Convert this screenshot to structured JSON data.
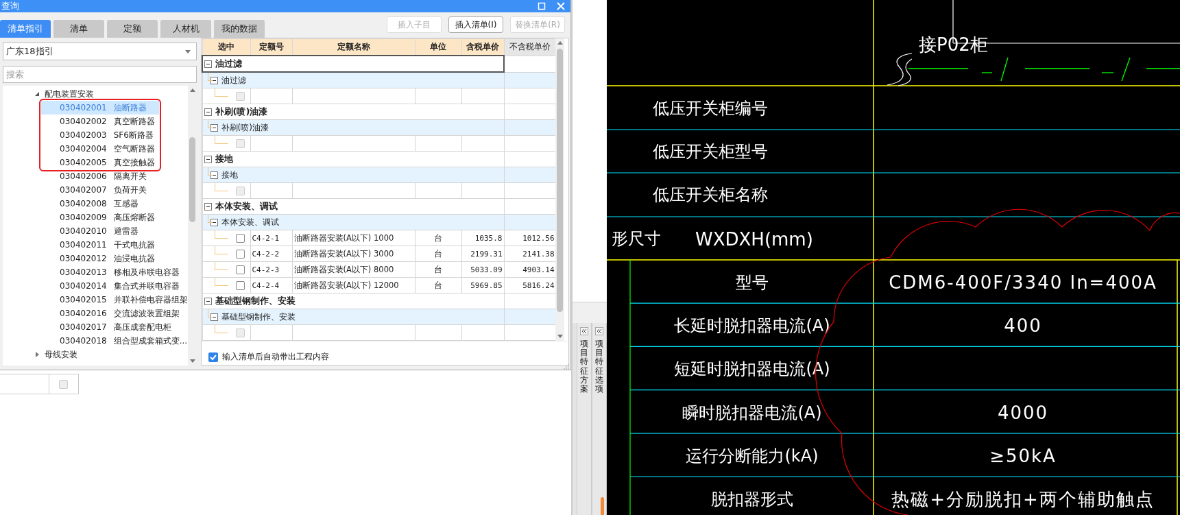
{
  "dialog": {
    "title": "查询",
    "tabs": [
      {
        "label": "清单指引",
        "selected": true
      },
      {
        "label": "清单",
        "selected": false
      },
      {
        "label": "定额",
        "selected": false
      },
      {
        "label": "人材机",
        "selected": false
      },
      {
        "label": "我的数据",
        "selected": false
      }
    ],
    "buttons": [
      {
        "label": "插入子目",
        "disabled": true
      },
      {
        "label": "插入清单(I)",
        "disabled": false
      },
      {
        "label": "替换清单(R)",
        "disabled": true
      }
    ],
    "guide": {
      "dropdown": "广东18指引",
      "search": {
        "placeholder": "搜索"
      },
      "tree": [
        {
          "label": "配电装置安装",
          "expanded": true,
          "children": [
            {
              "code": "030402001",
              "name": "油断路器",
              "selected": true,
              "highlighted": true
            },
            {
              "code": "030402002",
              "name": "真空断路器",
              "selected": false,
              "highlighted": true
            },
            {
              "code": "030402003",
              "name": "SF6断路器",
              "selected": false,
              "highlighted": true
            },
            {
              "code": "030402004",
              "name": "空气断路器",
              "selected": false,
              "highlighted": true
            },
            {
              "code": "030402005",
              "name": "真空接触器",
              "selected": false,
              "highlighted": true
            },
            {
              "code": "030402006",
              "name": "隔离开关",
              "selected": false,
              "highlighted": false
            },
            {
              "code": "030402007",
              "name": "负荷开关",
              "selected": false,
              "highlighted": false
            },
            {
              "code": "030402008",
              "name": "互感器",
              "selected": false,
              "highlighted": false
            },
            {
              "code": "030402009",
              "name": "高压熔断器",
              "selected": false,
              "highlighted": false
            },
            {
              "code": "030402010",
              "name": "避雷器",
              "selected": false,
              "highlighted": false
            },
            {
              "code": "030402011",
              "name": "干式电抗器",
              "selected": false,
              "highlighted": false
            },
            {
              "code": "030402012",
              "name": "油浸电抗器",
              "selected": false,
              "highlighted": false
            },
            {
              "code": "030402013",
              "name": "移相及串联电容器",
              "selected": false,
              "highlighted": false
            },
            {
              "code": "030402014",
              "name": "集合式并联电容器",
              "selected": false,
              "highlighted": false
            },
            {
              "code": "030402015",
              "name": "并联补偿电容器组架",
              "selected": false,
              "highlighted": false
            },
            {
              "code": "030402016",
              "name": "交流滤波装置组架",
              "selected": false,
              "highlighted": false
            },
            {
              "code": "030402017",
              "name": "高压成套配电柜",
              "selected": false,
              "highlighted": false
            },
            {
              "code": "030402018",
              "name": "组合型成套箱式变...",
              "selected": false,
              "highlighted": false
            }
          ]
        },
        {
          "label": "母线安装",
          "expanded": false
        }
      ]
    },
    "table": {
      "columns": [
        "选中",
        "定额号",
        "定额名称",
        "单位",
        "含税单价",
        "不含税单价"
      ],
      "rows": [
        {
          "kind": "group",
          "label": "油过滤",
          "expanded": true
        },
        {
          "kind": "subgroup",
          "label": "油过滤",
          "expanded": true
        },
        {
          "kind": "item",
          "checked": false,
          "disabled": true
        },
        {
          "kind": "group",
          "label": "补刷(喷)油漆",
          "expanded": true
        },
        {
          "kind": "subgroup",
          "label": "补刷(喷)油漆",
          "expanded": true
        },
        {
          "kind": "item",
          "checked": false,
          "disabled": true
        },
        {
          "kind": "group",
          "label": "接地",
          "expanded": true
        },
        {
          "kind": "subgroup",
          "label": "接地",
          "expanded": true
        },
        {
          "kind": "item",
          "checked": false,
          "disabled": true
        },
        {
          "kind": "group",
          "label": "本体安装、调试",
          "expanded": true
        },
        {
          "kind": "subgroup",
          "label": "本体安装、调试",
          "expanded": true
        },
        {
          "kind": "item",
          "checked": false,
          "disabled": false,
          "code": "C4-2-1",
          "name": "油断路器安装(A以下) 1000",
          "unit": "台",
          "tax_price": "1035.8",
          "pretax_price": "1012.56"
        },
        {
          "kind": "item",
          "checked": false,
          "disabled": false,
          "code": "C4-2-2",
          "name": "油断路器安装(A以下) 3000",
          "unit": "台",
          "tax_price": "2199.31",
          "pretax_price": "2141.38"
        },
        {
          "kind": "item",
          "checked": false,
          "disabled": false,
          "code": "C4-2-3",
          "name": "油断路器安装(A以下) 8000",
          "unit": "台",
          "tax_price": "5033.09",
          "pretax_price": "4903.14"
        },
        {
          "kind": "item",
          "checked": false,
          "disabled": false,
          "code": "C4-2-4",
          "name": "油断路器安装(A以下) 12000",
          "unit": "台",
          "tax_price": "5969.85",
          "pretax_price": "5816.24"
        },
        {
          "kind": "group",
          "label": "基础型钢制作、安装",
          "expanded": true
        },
        {
          "kind": "subgroup",
          "label": "基础型钢制作、安装",
          "expanded": true
        },
        {
          "kind": "item",
          "checked": false,
          "disabled": true
        }
      ]
    },
    "auto_option": {
      "label": "输入清单后自动带出工程内容",
      "checked": true
    }
  },
  "background_table": {
    "rows": [
      {
        "checked": false,
        "disabled": true
      }
    ]
  },
  "side_panel": {
    "tabs": [
      {
        "label": "项目特征方案"
      },
      {
        "label": "项目特征选项"
      }
    ]
  },
  "drawing": {
    "cable_label": "接P02柜",
    "header_rows": [
      {
        "label": "低压开关柜编号"
      },
      {
        "label": "低压开关柜型号"
      },
      {
        "label": "低压开关柜名称"
      }
    ],
    "dimension_row": {
      "label": "形尺寸",
      "value": "WXDXH(mm)"
    },
    "spec_rows": [
      {
        "label": "型号",
        "value": "CDM6-400F/3340 In=400A"
      },
      {
        "label": "长延时脱扣器电流(A)",
        "value": "400"
      },
      {
        "label": "短延时脱扣器电流(A)"
      },
      {
        "label": "瞬时脱扣器电流(A)",
        "value": "4000"
      },
      {
        "label": "运行分断能力(kA)",
        "value": "≥50kA"
      },
      {
        "label": "脱扣器形式",
        "value": "热磁+分励脱扣+两个辅助触点"
      }
    ]
  }
}
